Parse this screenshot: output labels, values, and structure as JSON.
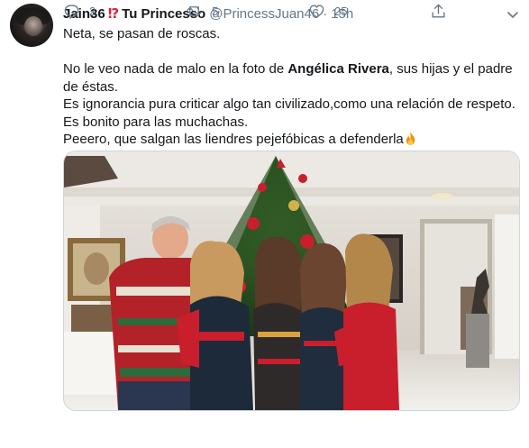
{
  "author": {
    "display_name": "Jain36",
    "name_emoji": "⁉",
    "display_name_suffix": "Tu Princesso",
    "handle": "@PrincessJuan46",
    "separator": "·",
    "time": "15h"
  },
  "tweet": {
    "line1": "Neta, se pasan de roscas.",
    "line2_before": "No le veo nada de malo en la foto de ",
    "line2_bold": "Angélica Rivera",
    "line2_after": ", sus hijas y el padre de éstas.",
    "line3": "Es ignorancia pura criticar algo tan civilizado,como una relación de respeto.",
    "line4": "Es bonito para las muchachas.",
    "line5": "Peeero, que salgan las liendres pejefóbicas a defenderla"
  },
  "actions": {
    "reply_count": "2",
    "retweet_count": "5",
    "like_count": "25"
  },
  "icons": {
    "reply": "reply-icon",
    "retweet": "retweet-icon",
    "like": "heart-icon",
    "share": "share-icon",
    "more": "chevron-down-icon"
  },
  "colors": {
    "secondary_text": "#657786",
    "border": "#ccd6dd"
  }
}
